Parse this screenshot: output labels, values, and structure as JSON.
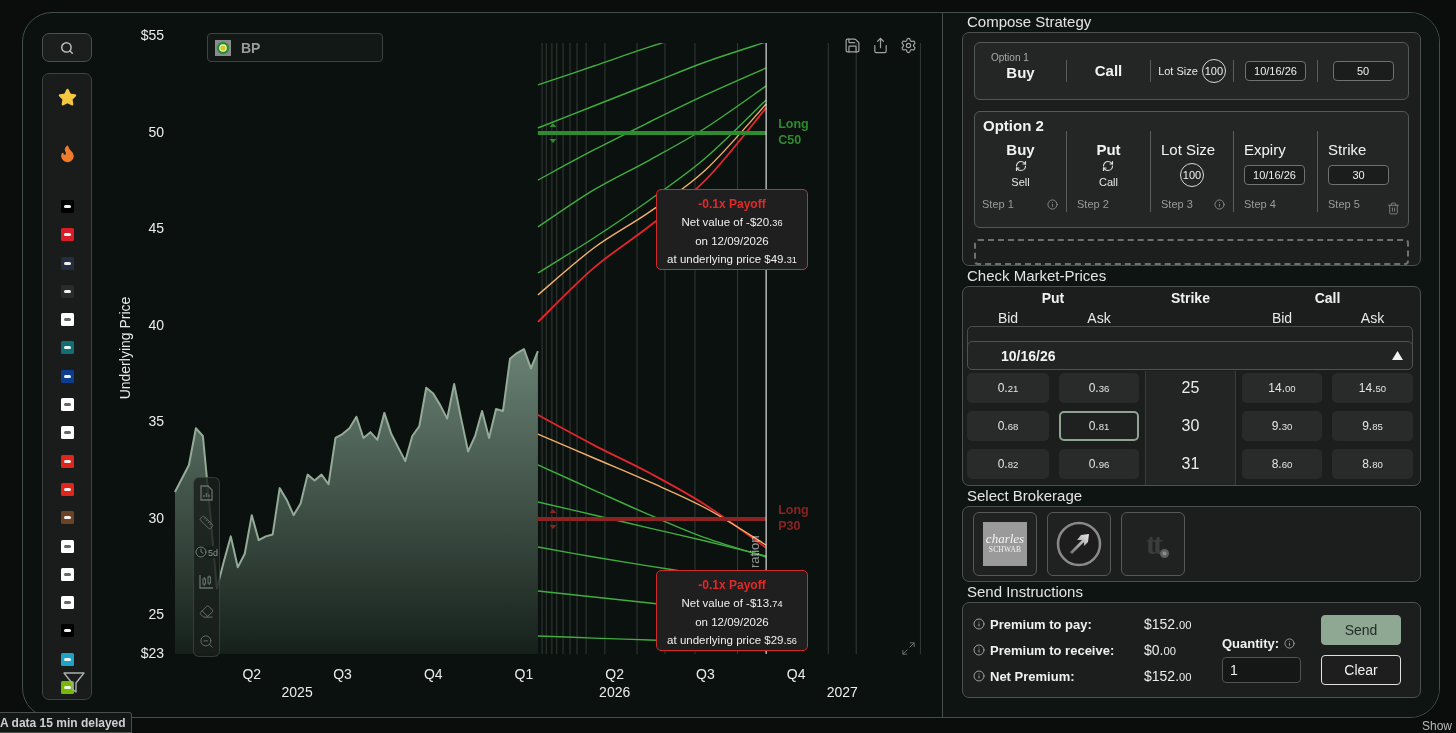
{
  "sidebar": {
    "watchlist": [
      {
        "color": "#000000"
      },
      {
        "color": "#d71e28"
      },
      {
        "color": "#232f3e"
      },
      {
        "color": "#2a2c2b"
      },
      {
        "color": "#ffffff"
      },
      {
        "color": "#0f6f73"
      },
      {
        "color": "#0b3d91"
      },
      {
        "color": "#ffffff"
      },
      {
        "color": "#ffffff"
      },
      {
        "color": "#e1251b"
      },
      {
        "color": "#e1251b"
      },
      {
        "color": "#6b4226"
      },
      {
        "color": "#ffffff"
      },
      {
        "color": "#ffffff"
      },
      {
        "color": "#ffffff"
      },
      {
        "color": "#000000"
      },
      {
        "color": "#1fa2c8"
      },
      {
        "color": "#76b900"
      }
    ]
  },
  "chart": {
    "ticker": "BP",
    "chart_data": {
      "type": "area",
      "ylabel": "Underlying Price",
      "ylim": [
        23,
        55
      ],
      "yticks": [
        {
          "value": 23,
          "label": "$23"
        },
        25,
        30,
        35,
        40,
        45,
        50,
        {
          "value": 55,
          "label": "$55"
        }
      ],
      "categories": [
        null,
        null,
        null,
        null,
        null,
        null,
        null,
        null,
        null,
        null,
        null,
        "Q2",
        null,
        null,
        null,
        null,
        null,
        null,
        null,
        null,
        null,
        null,
        null,
        null,
        "Q3",
        null,
        null,
        null,
        null,
        null,
        null,
        null,
        null,
        null,
        null,
        null,
        null,
        "Q4",
        null,
        null,
        null,
        null,
        null,
        null,
        null,
        null,
        null,
        null,
        null,
        null,
        "Q1",
        null,
        null,
        null,
        null,
        null,
        null,
        null,
        null,
        null,
        null,
        null,
        null,
        "Q2",
        null,
        null,
        null,
        null,
        null,
        null,
        null,
        null,
        null,
        null,
        null,
        null,
        "Q3",
        null,
        null,
        null,
        null,
        null,
        null,
        null,
        null,
        null,
        null,
        null,
        null,
        "Q4",
        null,
        null,
        null,
        null,
        null,
        null,
        null,
        null,
        null,
        null,
        null,
        null,
        null,
        null,
        null,
        null,
        null,
        null,
        null
      ],
      "series": [
        {
          "color": "#93ab98",
          "values": [
            31.4,
            32.1,
            32.8,
            34.7,
            34.3,
            30.5,
            26.4,
            27.8,
            29.1,
            27.5,
            28.2,
            30.2,
            28.9,
            29.1,
            29.2,
            31.6,
            31.0,
            30.2,
            30.8,
            32.3,
            32.0,
            32.3,
            31.8,
            34.2,
            34.4,
            34.7,
            35.3,
            34.2,
            34.5,
            34.1,
            35.5,
            34.4,
            33.7,
            33.0,
            34.3,
            34.8,
            36.8,
            36.5,
            35.9,
            35.2,
            37.0,
            35.2,
            33.5,
            34.3,
            35.6,
            34.2,
            35.7,
            35.6,
            38.3,
            38.6,
            38.8,
            37.8,
            38.7,
            null,
            null,
            null,
            null,
            null,
            null,
            null,
            null,
            null,
            null,
            null,
            null,
            null,
            null,
            null,
            null,
            null,
            null,
            null,
            null,
            null,
            null,
            null,
            null,
            null,
            null,
            null,
            null,
            null,
            null,
            null,
            null,
            null,
            null,
            null,
            null,
            null,
            null,
            null,
            null,
            null,
            null,
            null,
            null,
            null,
            null,
            null,
            null,
            null,
            null,
            null,
            null,
            null,
            null,
            null,
            null
          ]
        }
      ]
    },
    "year_labels": [
      "2025",
      "2026",
      "2027"
    ],
    "strikes": [
      {
        "label": "Long C50",
        "color": "#2e8b2e"
      },
      {
        "label": "Long P30",
        "color": "#8c2222"
      }
    ],
    "expiration_label": "ration",
    "tooltips": [
      {
        "title": "-0.1x Payoff",
        "lines": [
          "Net value of -$20.36",
          "on 12/09/2026",
          "at underlying price $49.31"
        ]
      },
      {
        "title": "-0.1x Payoff",
        "lines": [
          "Net value of -$13.74",
          "on 12/09/2026",
          "at underlying price $29.56"
        ]
      }
    ],
    "tools": {
      "timeframe": "5d"
    }
  },
  "compose": {
    "title": "Compose Strategy",
    "options": [
      {
        "expanded": false,
        "label": "Option 1",
        "action": "Buy",
        "type": "Call",
        "lot_label": "Lot Size",
        "lot_size": "100",
        "expiry": "10/16/26",
        "strike": "50"
      },
      {
        "expanded": true,
        "label": "Option 2",
        "action": "Buy",
        "action_alt": "Sell",
        "type": "Put",
        "type_alt": "Call",
        "lot_label": "Lot Size",
        "lot_size": "100",
        "expiry_label": "Expiry",
        "expiry": "10/16/26",
        "strike_label": "Strike",
        "strike": "30",
        "steps": [
          "Step 1",
          "Step 2",
          "Step 3",
          "Step 4",
          "Step 5"
        ]
      }
    ]
  },
  "market": {
    "title": "Check Market-Prices",
    "put_label": "Put",
    "strike_label": "Strike",
    "call_label": "Call",
    "subcolumns": [
      "Bid",
      "Ask",
      "Bid",
      "Ask"
    ],
    "expiry": "10/16/26",
    "rows": [
      {
        "strike": "25",
        "put": [
          {
            "price": "0.21",
            "selected": false
          },
          {
            "price": "0.36",
            "selected": false
          }
        ],
        "call": [
          {
            "price": "14.00",
            "selected": false
          },
          {
            "price": "14.50",
            "selected": false
          }
        ]
      },
      {
        "strike": "30",
        "put": [
          {
            "price": "0.68",
            "selected": false
          },
          {
            "price": "0.81",
            "selected": true
          }
        ],
        "call": [
          {
            "price": "9.30",
            "selected": false
          },
          {
            "price": "9.85",
            "selected": false
          }
        ]
      },
      {
        "strike": "31",
        "put": [
          {
            "price": "0.82",
            "selected": false
          },
          {
            "price": "0.96",
            "selected": false
          }
        ],
        "call": [
          {
            "price": "8.60",
            "selected": false
          },
          {
            "price": "8.80",
            "selected": false
          }
        ]
      }
    ]
  },
  "brokerage": {
    "title": "Select Brokerage",
    "brokers": [
      {
        "kind": "wordmark",
        "lines": [
          "charles",
          "SCHWAB"
        ]
      },
      {
        "kind": "arrow"
      },
      {
        "kind": "monogram",
        "text": "tt"
      }
    ]
  },
  "instructions": {
    "title": "Send Instructions",
    "rows": [
      {
        "label": "Premium to pay:",
        "value": "$152.00"
      },
      {
        "label": "Premium to receive:",
        "value": "$0.00"
      },
      {
        "label": "Net Premium:",
        "value": "$152.00"
      }
    ],
    "quantity_label": "Quantity:",
    "quantity": "1",
    "buttons": [
      {
        "kind": "primary",
        "label": "Send"
      },
      {
        "kind": "secondary",
        "label": "Clear"
      }
    ]
  },
  "footer": {
    "notice": "A data 15 min delayed",
    "show": "Show"
  }
}
